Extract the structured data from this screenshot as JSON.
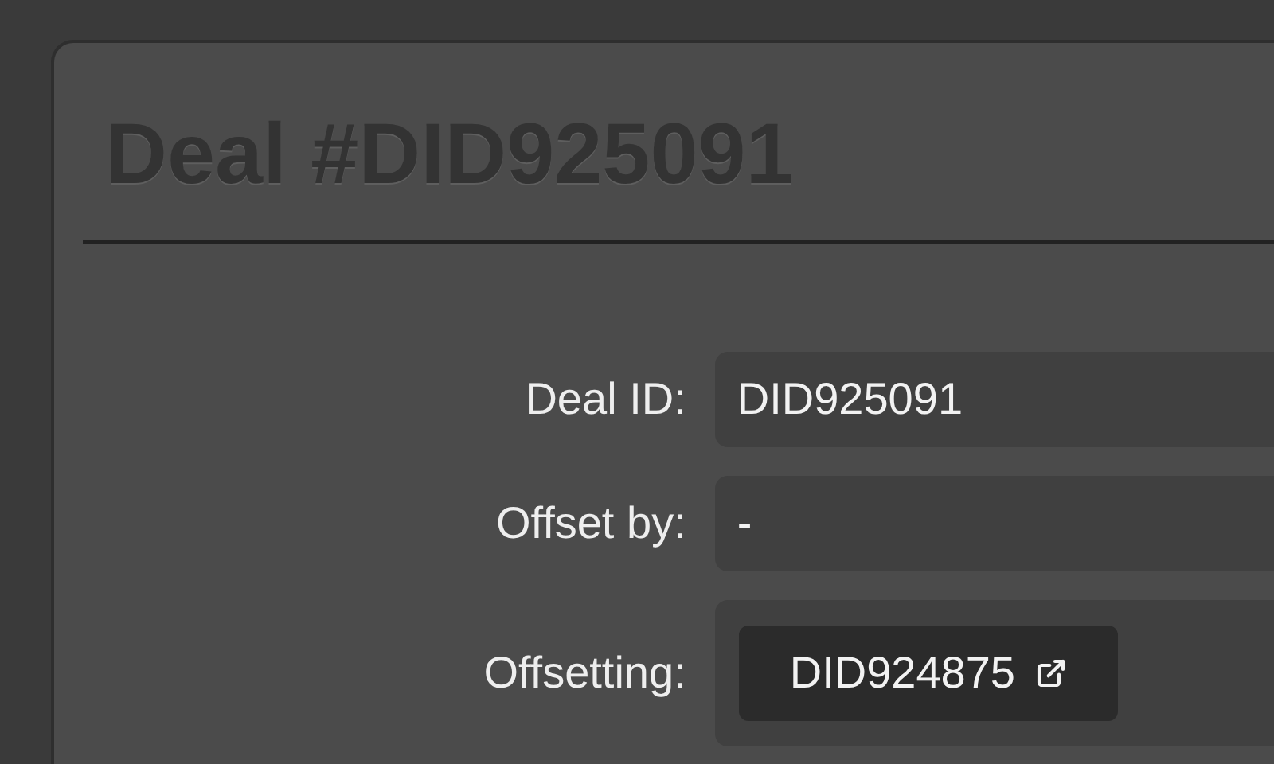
{
  "title": "Deal #DID925091",
  "fields": [
    {
      "label": "Deal ID:",
      "kind": "text",
      "value": "DID925091"
    },
    {
      "label": "Offset by:",
      "kind": "text",
      "value": "-"
    },
    {
      "label": "Offsetting:",
      "kind": "link",
      "value": "DID924875"
    }
  ]
}
